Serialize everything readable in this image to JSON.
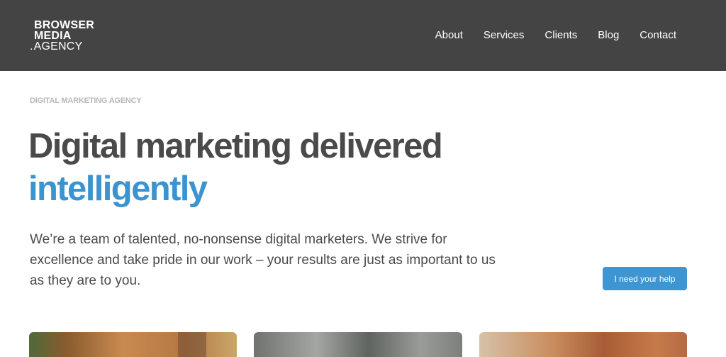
{
  "header": {
    "logo": {
      "line1": "BROWSER",
      "line2": "MEDIA",
      "line3_prefix": ".",
      "line3": "AGENCY"
    },
    "nav": [
      {
        "label": "About"
      },
      {
        "label": "Services"
      },
      {
        "label": "Clients"
      },
      {
        "label": "Blog"
      },
      {
        "label": "Contact"
      }
    ]
  },
  "hero": {
    "eyebrow": "DIGITAL MARKETING AGENCY",
    "headline": "Digital marketing delivered",
    "headline_accent": "intelligently",
    "intro": "We’re a team of talented, no-nonsense digital marketers. We strive for excellence and take pride in our work – your results are just as important to us as they are to you.",
    "cta_label": "I need your help"
  },
  "colors": {
    "header_bg": "#444444",
    "accent": "#3b93d0",
    "button_bg": "#3d96d3",
    "text": "#4a4a4a",
    "eyebrow": "#b8b8b8"
  }
}
